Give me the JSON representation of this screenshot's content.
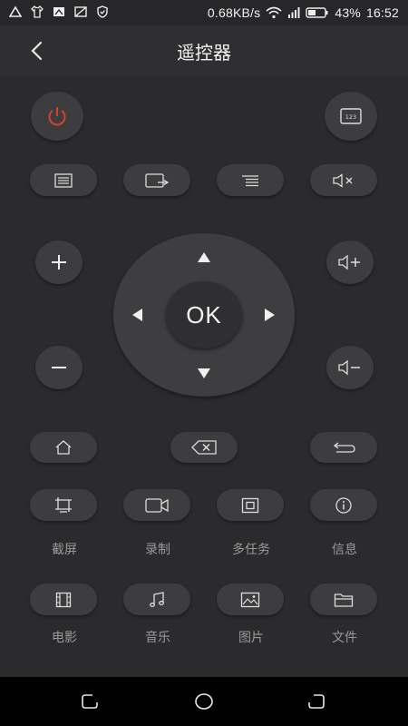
{
  "status_bar": {
    "net_speed": "0.68KB/s",
    "battery": "43%",
    "time": "16:52"
  },
  "header": {
    "title": "遥控器"
  },
  "remote": {
    "ok_label": "OK",
    "power_color": "#d9412c",
    "functions": [
      {
        "label": "截屏",
        "icon": "screenshot-icon"
      },
      {
        "label": "录制",
        "icon": "video-camera-icon"
      },
      {
        "label": "多任务",
        "icon": "multitask-icon"
      },
      {
        "label": "信息",
        "icon": "info-icon"
      },
      {
        "label": "电影",
        "icon": "film-icon"
      },
      {
        "label": "音乐",
        "icon": "music-note-icon"
      },
      {
        "label": "图片",
        "icon": "picture-icon"
      },
      {
        "label": "文件",
        "icon": "folder-icon"
      }
    ]
  }
}
